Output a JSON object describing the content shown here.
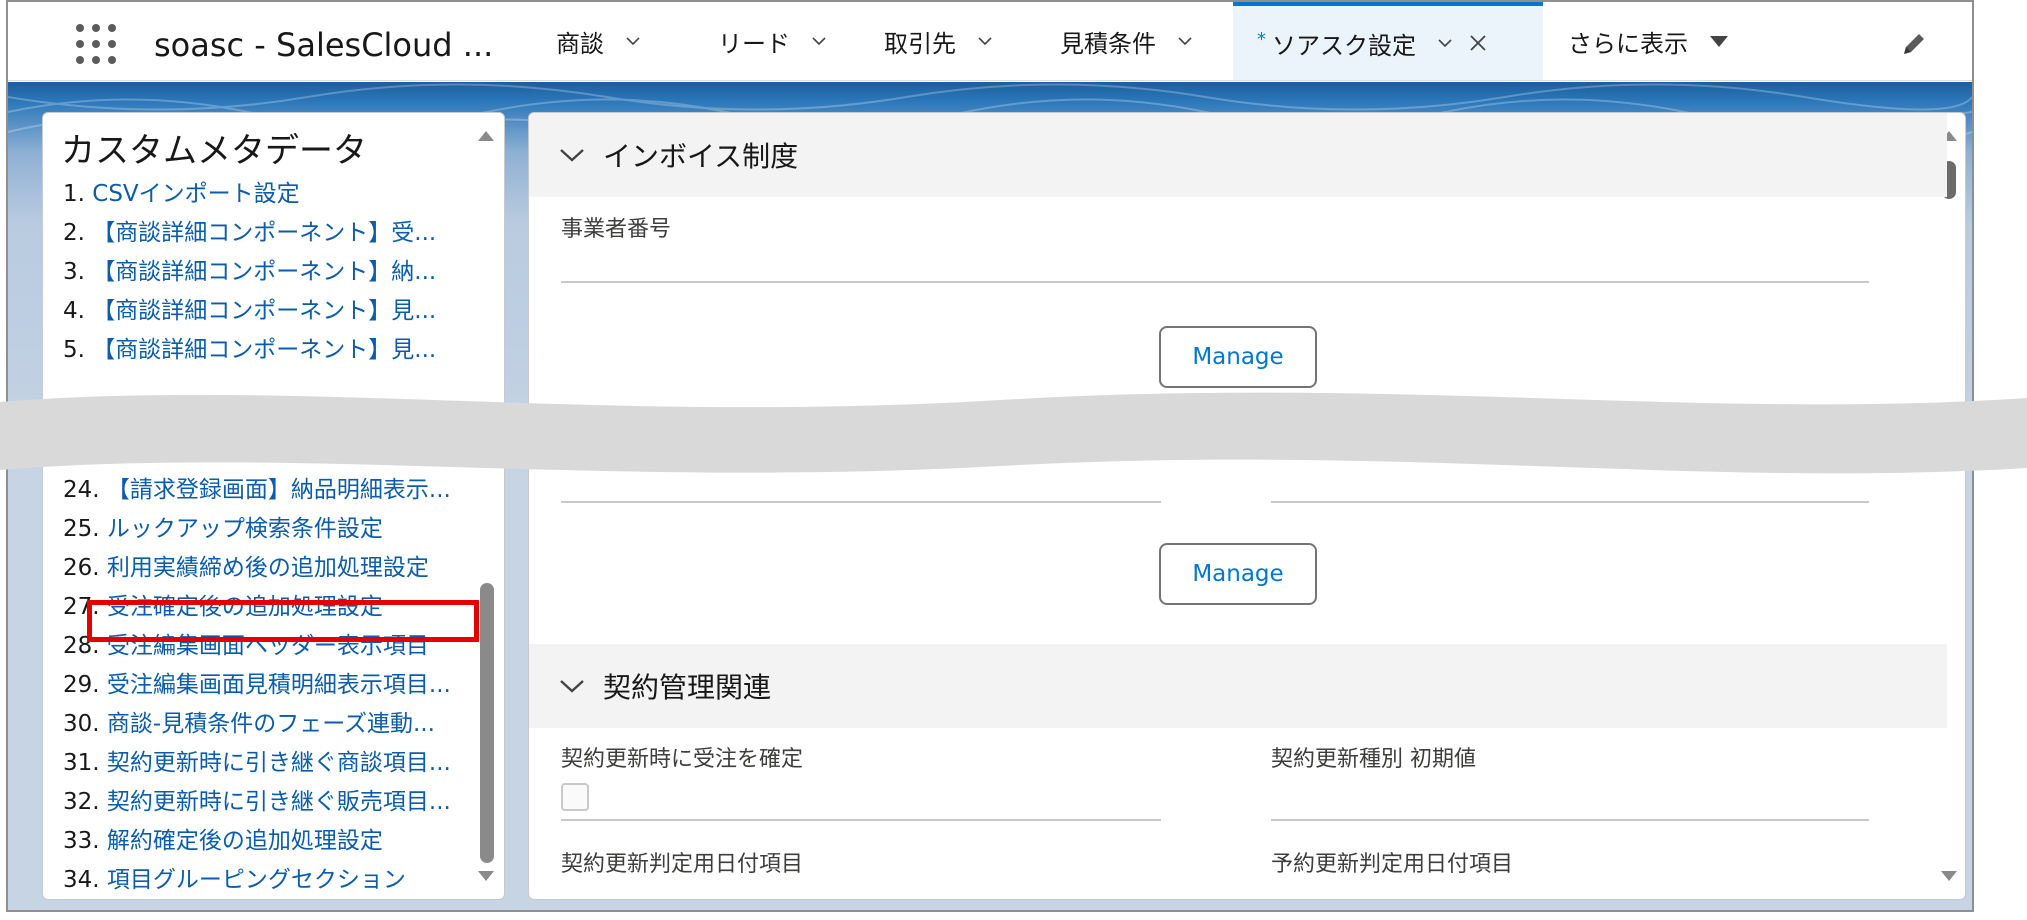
{
  "app": {
    "name": "soasc - SalesCloud ..."
  },
  "nav_tabs": [
    {
      "label": "商談"
    },
    {
      "label": "リード"
    },
    {
      "label": "取引先"
    },
    {
      "label": "見積条件"
    }
  ],
  "active_tab": {
    "star": "*",
    "label": "ソアスク設定"
  },
  "more_tab": {
    "label": "さらに表示"
  },
  "left_panel": {
    "title": "カスタムメタデータ",
    "items_top": [
      {
        "num": "1.",
        "text": "CSVインポート設定"
      },
      {
        "num": "2.",
        "text": "【商談詳細コンポーネント】受..."
      },
      {
        "num": "3.",
        "text": "【商談詳細コンポーネント】納..."
      },
      {
        "num": "4.",
        "text": "【商談詳細コンポーネント】見..."
      },
      {
        "num": "5.",
        "text": "【商談詳細コンポーネント】見..."
      }
    ],
    "items_bottom": [
      {
        "num": "24.",
        "text": "【請求登録画面】納品明細表示..."
      },
      {
        "num": "25.",
        "text": "ルックアップ検索条件設定"
      },
      {
        "num": "26.",
        "text": "利用実績締め後の追加処理設定"
      },
      {
        "num": "27.",
        "text": "受注確定後の追加処理設定"
      },
      {
        "num": "28.",
        "text": "受注編集画面ヘッダー表示項目"
      },
      {
        "num": "29.",
        "text": "受注編集画面見積明細表示項目..."
      },
      {
        "num": "30.",
        "text": "商談-見積条件のフェーズ連動..."
      },
      {
        "num": "31.",
        "text": "契約更新時に引き継ぐ商談項目..."
      },
      {
        "num": "32.",
        "text": "契約更新時に引き継ぐ販売項目..."
      },
      {
        "num": "33.",
        "text": "解約確定後の追加処理設定"
      },
      {
        "num": "34.",
        "text": "項目グルーピングセクション"
      }
    ]
  },
  "right_panel": {
    "section1": {
      "title": "インボイス制度",
      "field1_label": "事業者番号",
      "manage1": "Manage",
      "manage2": "Manage"
    },
    "section2": {
      "title": "契約管理関連",
      "field_renew_confirm": "契約更新時に受注を確定",
      "field_renew_type": "契約更新種別 初期値",
      "field_renew_date": "契約更新判定用日付項目",
      "field_reserve_date": "予約更新判定用日付項目"
    }
  },
  "colors": {
    "accent": "#0176d3",
    "link": "#0b5cab",
    "highlight": "#e40000",
    "band": "#2c78bb"
  }
}
